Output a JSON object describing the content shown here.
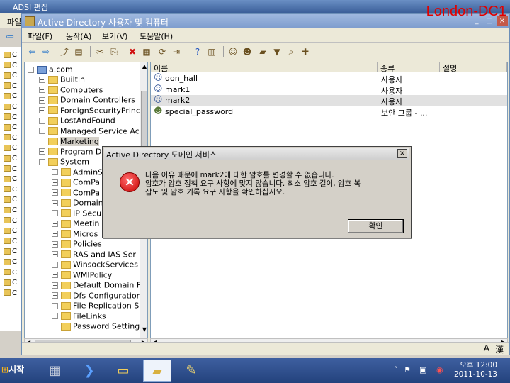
{
  "background_window": {
    "title": "ADSI 편집",
    "menu_first": "파일",
    "tree_stub": [
      "C",
      "C",
      "C",
      "C",
      "C",
      "C",
      "C",
      "C",
      "C",
      "C",
      "C",
      "C",
      "C",
      "C",
      "C",
      "C",
      "C",
      "C",
      "C",
      "C",
      "C",
      "C",
      "C",
      "C"
    ]
  },
  "window": {
    "title": "Active Directory 사용자 및 컴퓨터",
    "hostname": "London-DC1",
    "buttons": {
      "minimize": "_",
      "maximize": "□",
      "close": "×"
    }
  },
  "menubar": [
    "파일(F)",
    "동작(A)",
    "보기(V)",
    "도움말(H)"
  ],
  "toolbar_icons": [
    "back-icon",
    "forward-icon",
    "up-icon",
    "show-icon",
    "cut-icon",
    "copy-icon",
    "delete-icon",
    "properties-icon",
    "refresh-icon",
    "export-icon",
    "help-icon",
    "view-icon",
    "user-icon",
    "group-icon",
    "ou-icon",
    "filter-icon",
    "find-icon",
    "add-icon"
  ],
  "tree": {
    "root": "a.com",
    "items": [
      {
        "label": "Builtin",
        "level": 1,
        "expand": "+"
      },
      {
        "label": "Computers",
        "level": 1,
        "expand": "+"
      },
      {
        "label": "Domain Controllers",
        "level": 1,
        "expand": "+"
      },
      {
        "label": "ForeignSecurityPrinc",
        "level": 1,
        "expand": "+"
      },
      {
        "label": "LostAndFound",
        "level": 1,
        "expand": "+"
      },
      {
        "label": "Managed Service Ac",
        "level": 1,
        "expand": "+"
      },
      {
        "label": "Marketing",
        "level": 1,
        "expand": "",
        "selected": true
      },
      {
        "label": "Program D",
        "level": 1,
        "expand": "+"
      },
      {
        "label": "System",
        "level": 1,
        "expand": "-"
      },
      {
        "label": "AdminS",
        "level": 2,
        "expand": "+"
      },
      {
        "label": "ComPa",
        "level": 2,
        "expand": "+"
      },
      {
        "label": "ComPa",
        "level": 2,
        "expand": "+"
      },
      {
        "label": "Domain",
        "level": 2,
        "expand": "+"
      },
      {
        "label": "IP Secu",
        "level": 2,
        "expand": "+"
      },
      {
        "label": "Meetin",
        "level": 2,
        "expand": "+"
      },
      {
        "label": "Micros",
        "level": 2,
        "expand": "+"
      },
      {
        "label": "Policies",
        "level": 2,
        "expand": "+"
      },
      {
        "label": "RAS and IAS Ser",
        "level": 2,
        "expand": "+"
      },
      {
        "label": "WinsockServices",
        "level": 2,
        "expand": "+"
      },
      {
        "label": "WMIPolicy",
        "level": 2,
        "expand": "+"
      },
      {
        "label": "Default Domain F",
        "level": 2,
        "expand": "+"
      },
      {
        "label": "Dfs-Configuration",
        "level": 2,
        "expand": "+"
      },
      {
        "label": "File Replication S",
        "level": 2,
        "expand": "+"
      },
      {
        "label": "FileLinks",
        "level": 2,
        "expand": "+"
      },
      {
        "label": "Password Setting",
        "level": 2,
        "expand": ""
      }
    ]
  },
  "list": {
    "columns": [
      "이름",
      "종류",
      "설명"
    ],
    "rows": [
      {
        "name": "don_hall",
        "type": "사용자",
        "icon": "user-icon"
      },
      {
        "name": "mark1",
        "type": "사용자",
        "icon": "user-icon"
      },
      {
        "name": "mark2",
        "type": "사용자",
        "icon": "user-icon",
        "selected": true
      },
      {
        "name": "special_password",
        "type": "보안 그룹 - ...",
        "icon": "group-icon"
      }
    ]
  },
  "dialog": {
    "title": "Active Directory 도메인 서비스",
    "close": "×",
    "icon": "×",
    "message_lines": [
      "다음 이유 때문에 mark2에 대한 암호를 변경할 수 없습니다.",
      "암호가 암호 정책 요구 사항에 맞지 않습니다. 최소 암호 길이, 암호 복",
      "잡도 및 암호 기록 요구 사항을 확인하십시오."
    ],
    "ok_label": "확인"
  },
  "status_icons": {
    "lang": "A",
    "ime": "漢"
  },
  "taskbar": {
    "start_label": "시작",
    "items": [
      "server-manager-icon",
      "powershell-icon",
      "explorer-icon",
      "adsi-icon",
      "notepad-icon"
    ],
    "active_index": 3,
    "clock_period": "오후 12:00",
    "clock_date": "2011-10-13"
  },
  "colors": {
    "hostname": "#e00000",
    "error": "#c80000",
    "taskbar": "#23427d"
  }
}
